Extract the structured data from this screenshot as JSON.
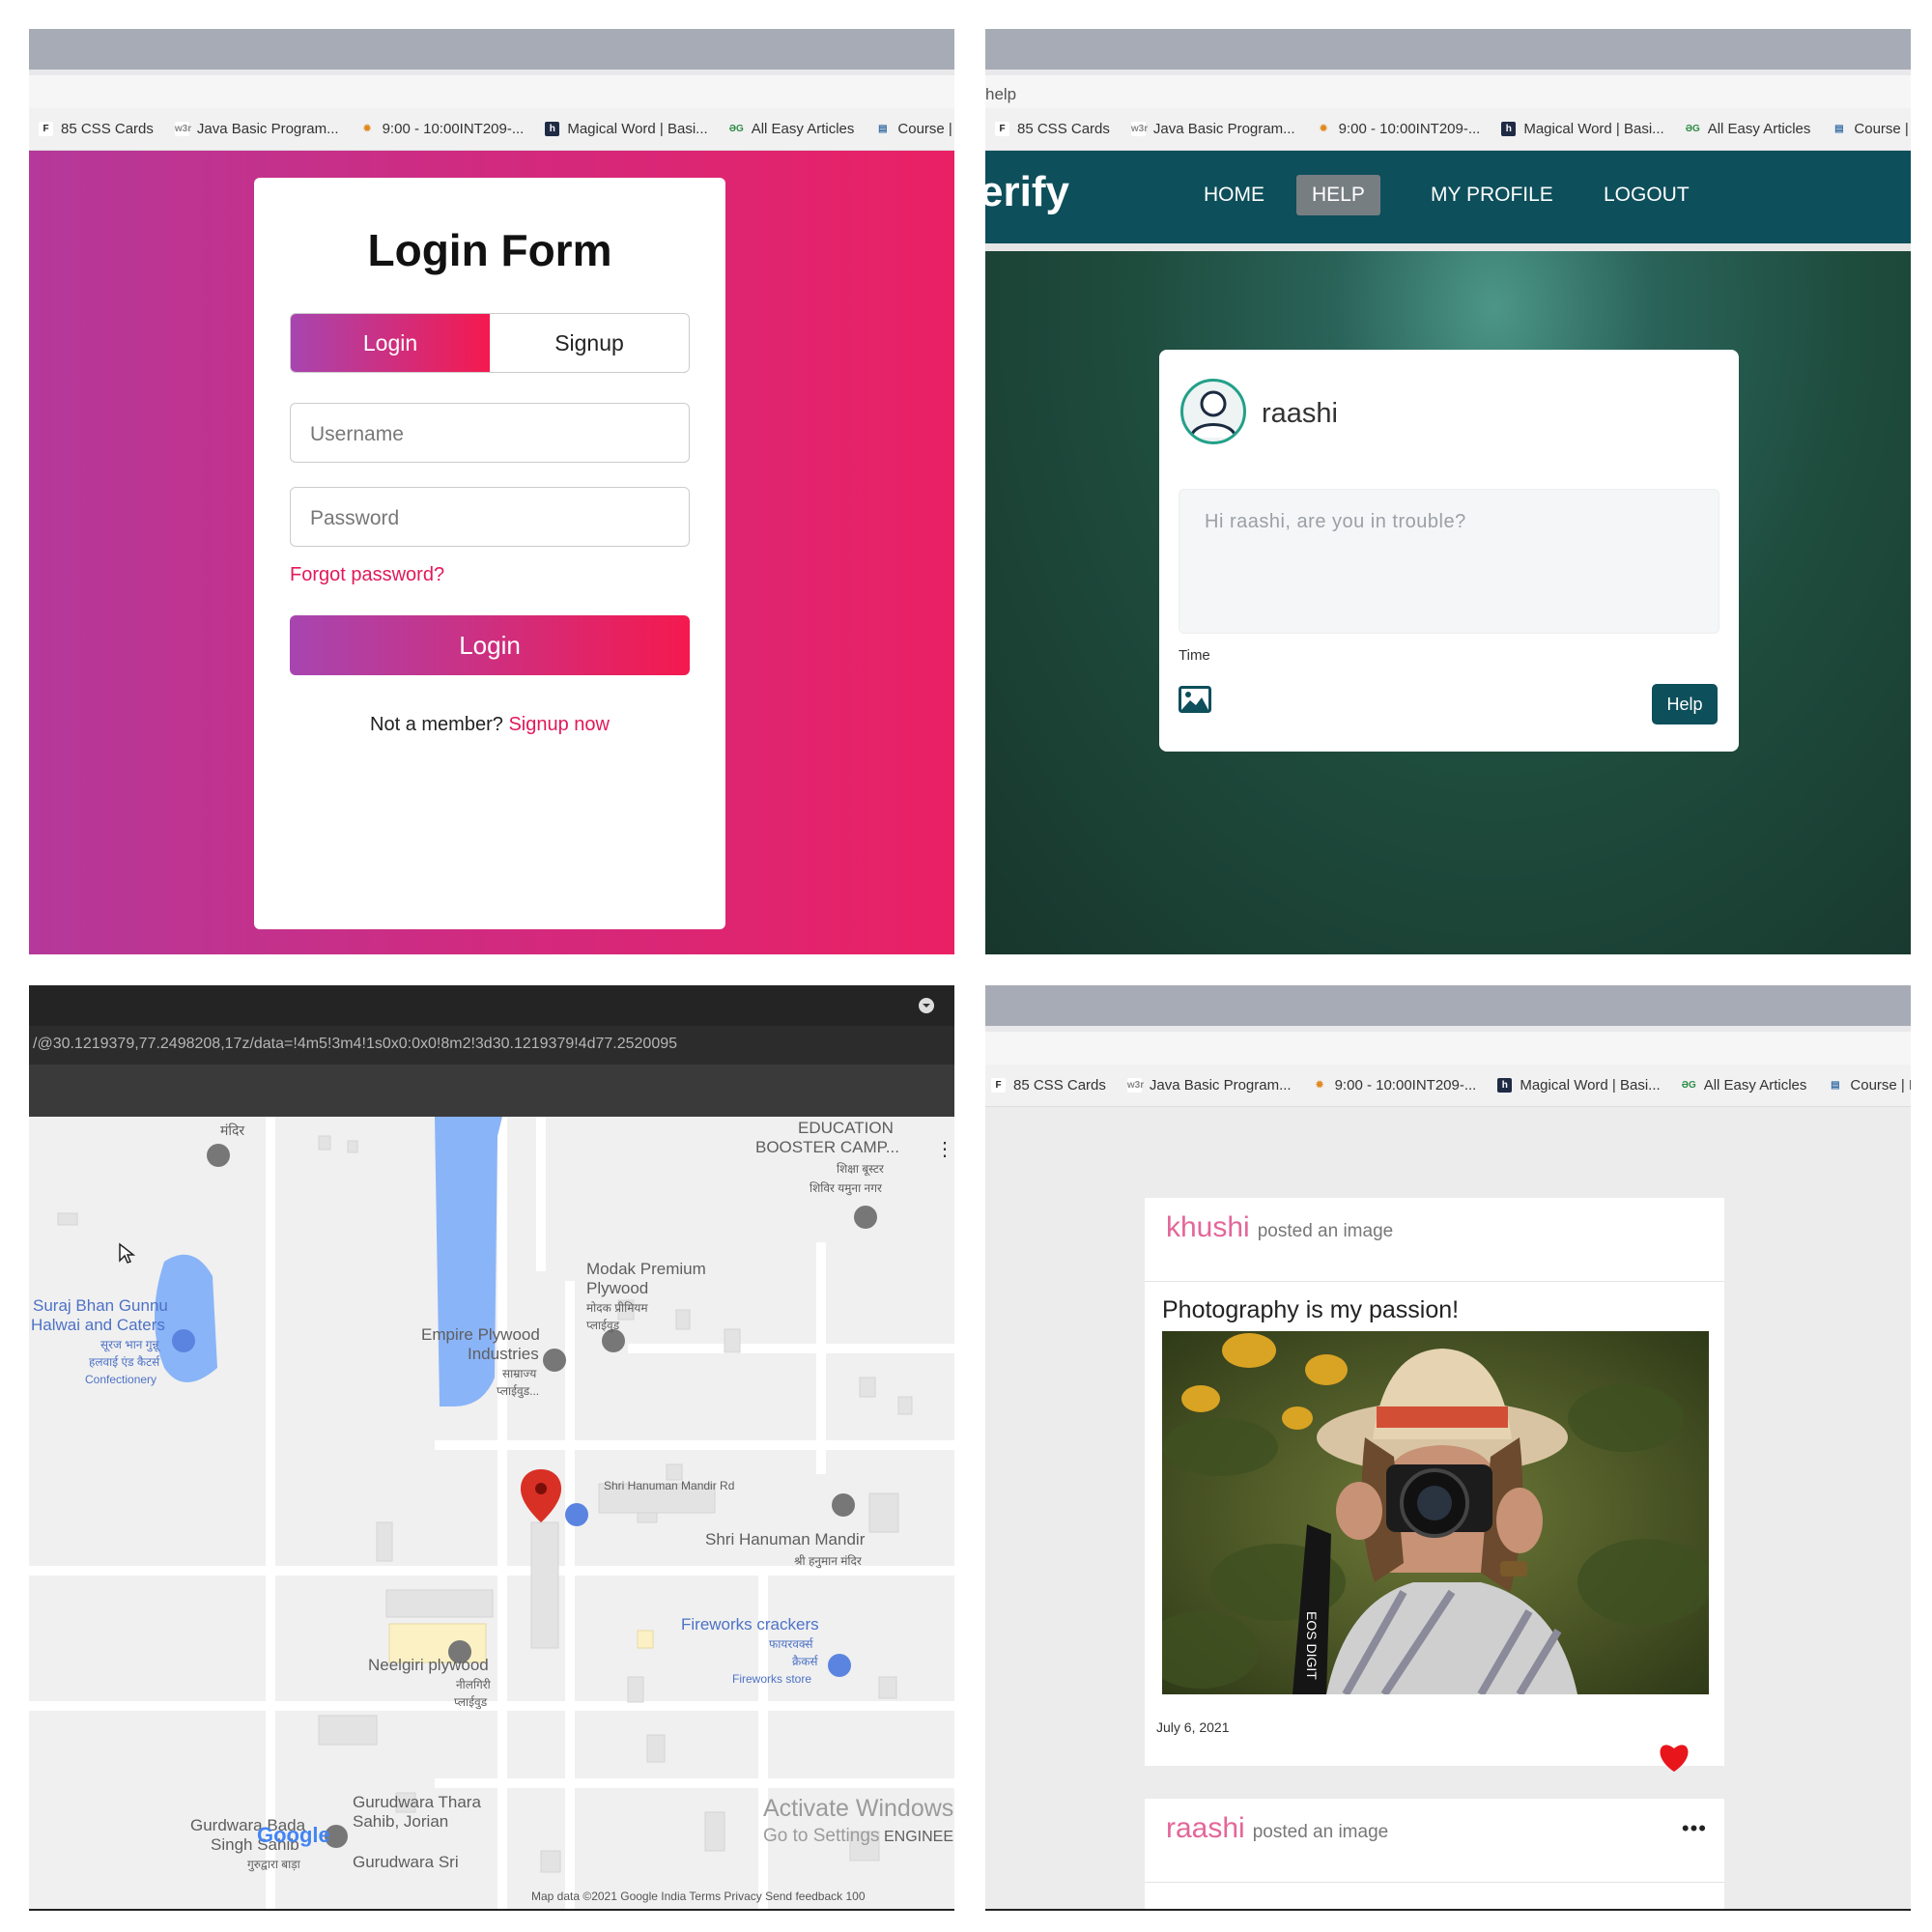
{
  "bookmarks": [
    {
      "label": "85 CSS Cards",
      "icon": "f-icon"
    },
    {
      "label": "Java Basic Program...",
      "icon": "w3r-icon"
    },
    {
      "label": "9:00 - 10:00INT209-...",
      "icon": "sun-icon"
    },
    {
      "label": "Magical Word | Basi...",
      "icon": "h-icon"
    },
    {
      "label": "All Easy Articles",
      "icon": "gfg-icon"
    },
    {
      "label": "Course | M",
      "icon": "book-icon"
    }
  ],
  "login": {
    "title": "Login Form",
    "tab_login": "Login",
    "tab_signup": "Signup",
    "username_placeholder": "Username",
    "password_placeholder": "Password",
    "forgot": "Forgot password?",
    "submit": "Login",
    "not_member": "Not a member?",
    "signup_link": "Signup now",
    "colors": {
      "gradient_start": "#a745b0",
      "gradient_end": "#f5194f",
      "link": "#e2195a"
    }
  },
  "help_page": {
    "url": "help",
    "brand": "erify",
    "nav": [
      "HOME",
      "HELP",
      "MY PROFILE",
      "LOGOUT"
    ],
    "active_nav": "HELP",
    "username": "raashi",
    "textarea_placeholder": "Hi raashi, are you in trouble?",
    "time_label": "Time",
    "help_button": "Help",
    "colors": {
      "nav_bg": "#0d4f5b"
    }
  },
  "map": {
    "url": "/@30.1219379,77.2498208,17z/data=!4m5!3m4!1s0x0:0x0!8m2!3d30.1219379!4d77.2520095",
    "labels": {
      "temple": "मंदिर",
      "edu_1": "EDUCATION",
      "edu_2": "BOOSTER CAMP...",
      "edu_3": "शिक्षा बूस्टर",
      "edu_4": "शिविर यमुना नगर",
      "suraj_1": "Suraj Bhan Gunnu",
      "suraj_2": "Halwai and Caters",
      "suraj_3": "सूरज भान गुन्नू",
      "suraj_4": "हलवाई एंड कैटर्स",
      "suraj_5": "Confectionery",
      "modak_1": "Modak Premium",
      "modak_2": "Plywood",
      "modak_3": "मोदक प्रीमियम",
      "modak_4": "प्लाईवुड",
      "empire_1": "Empire Plywood",
      "empire_2": "Industries",
      "empire_3": "साम्राज्य",
      "empire_4": "प्लाईवुड...",
      "road": "Shri Hanuman Mandir Rd",
      "hanuman_1": "Shri Hanuman Mandir",
      "hanuman_2": "श्री हनुमान मंदिर",
      "fire_1": "Fireworks crackers",
      "fire_2": "फायरवर्क्स",
      "fire_3": "क्रैकर्स",
      "fire_4": "Fireworks store",
      "neel_1": "Neelgiri plywood",
      "neel_2": "नीलगिरी",
      "neel_3": "प्लाईवुड",
      "gur_1": "Gurudwara Thara",
      "gur_2": "Sahib, Jorian",
      "gur_3": "Gurudwara Sri",
      "bada_1": "Gurdwara Bada",
      "bada_2": "Singh Sahib",
      "bada_3": "गुरुद्वारा बाड़ा",
      "google": "Google",
      "activate_1": "Activate Windows",
      "activate_2": "Go to Settings",
      "engineer": "ENGINEEI",
      "footer": "Map data ©2021 Google   India   Terms   Privacy   Send feedback   100"
    }
  },
  "feed": {
    "posts": [
      {
        "user": "khushi",
        "action": "posted an image",
        "caption": "Photography is my passion!",
        "date": "July 6, 2021",
        "liked": true,
        "camera_text": "EOS DIGIT"
      },
      {
        "user": "raashi",
        "action": "posted an image",
        "more": "•••"
      }
    ]
  }
}
